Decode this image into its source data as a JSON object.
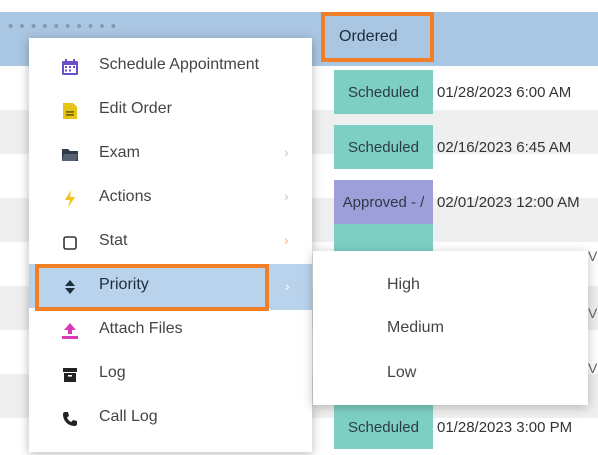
{
  "grid": {
    "header_faded": "• • • • • • • • • •",
    "status_header": "Ordered",
    "rows": [
      {
        "status": "Scheduled",
        "date": "01/28/2023 6:00 AM",
        "kind": "teal"
      },
      {
        "status": "Scheduled",
        "date": "02/16/2023 6:45 AM",
        "kind": "teal"
      },
      {
        "status": "Approved - /",
        "date": "02/01/2023 12:00 AM",
        "kind": "purple"
      },
      {
        "status": "",
        "date": "",
        "kind": "teal"
      },
      {
        "status": "",
        "date": "",
        "kind": "teal"
      },
      {
        "status": "",
        "date": "",
        "kind": "teal"
      },
      {
        "status": "",
        "date": "",
        "kind": "teal"
      },
      {
        "status": "Scheduled",
        "date": "01/28/2023 3:00 PM",
        "kind": "teal"
      }
    ],
    "edge_v": "V"
  },
  "menu": {
    "items": [
      {
        "label": "Schedule Appointment",
        "icon": "calendar-icon"
      },
      {
        "label": "Edit Order",
        "icon": "edit-document-icon"
      },
      {
        "label": "Exam",
        "icon": "folder-icon",
        "submenu": true
      },
      {
        "label": "Actions",
        "icon": "lightning-icon",
        "submenu": true
      },
      {
        "label": "Stat",
        "icon": "checkbox-icon",
        "submenu": true
      },
      {
        "label": "Priority",
        "icon": "sort-icon",
        "submenu": true,
        "active": true
      },
      {
        "label": "Attach Files",
        "icon": "upload-icon"
      },
      {
        "label": "Log",
        "icon": "archive-icon"
      },
      {
        "label": "Call Log",
        "icon": "phone-icon"
      }
    ]
  },
  "submenu": {
    "items": [
      "High",
      "Medium",
      "Low"
    ]
  },
  "colors": {
    "highlight": "#f07f28",
    "header": "#a9c6e2",
    "teal": "#7dcfc4",
    "purple": "#9d9fdb",
    "active_item": "#b9d3ec"
  }
}
